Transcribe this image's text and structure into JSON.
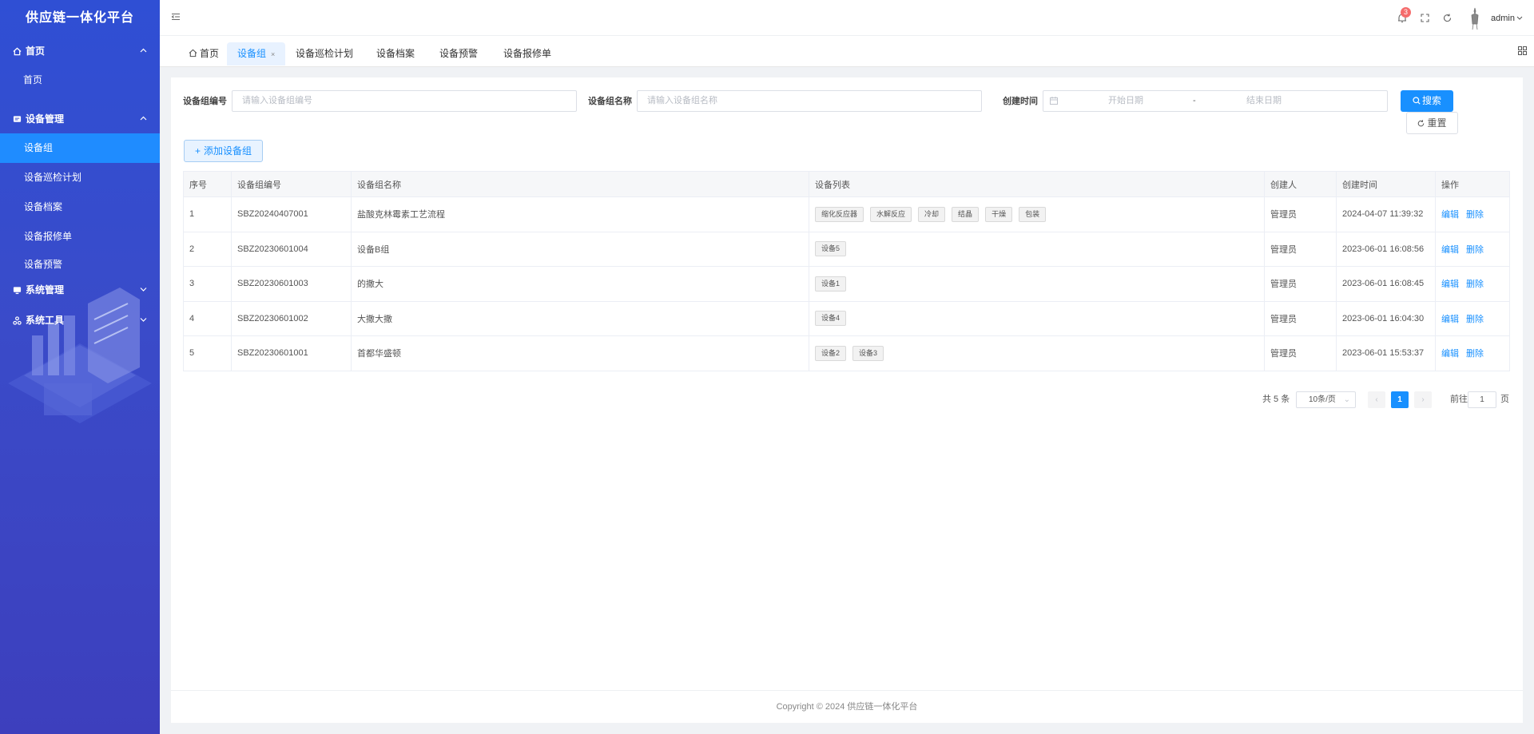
{
  "app": {
    "title": "供应链一体化平台"
  },
  "sidebar": {
    "groups": [
      {
        "label": "首页",
        "icon": "home-icon",
        "expanded": true,
        "items": [
          {
            "label": "首页",
            "active": false
          }
        ]
      },
      {
        "label": "设备管理",
        "icon": "device-icon",
        "expanded": true,
        "items": [
          {
            "label": "设备组",
            "active": true
          },
          {
            "label": "设备巡检计划",
            "active": false
          },
          {
            "label": "设备档案",
            "active": false
          },
          {
            "label": "设备报修单",
            "active": false
          },
          {
            "label": "设备预警",
            "active": false
          }
        ]
      },
      {
        "label": "系统管理",
        "icon": "monitor-icon",
        "expanded": false,
        "items": []
      },
      {
        "label": "系统工具",
        "icon": "tools-icon",
        "expanded": false,
        "items": []
      }
    ]
  },
  "header": {
    "notification_count": "3",
    "username": "admin"
  },
  "tabs": [
    {
      "label": "首页",
      "active": false,
      "closable": false
    },
    {
      "label": "设备组",
      "active": true,
      "closable": true
    },
    {
      "label": "设备巡检计划",
      "active": false,
      "closable": false
    },
    {
      "label": "设备档案",
      "active": false,
      "closable": false
    },
    {
      "label": "设备预警",
      "active": false,
      "closable": false
    },
    {
      "label": "设备报修单",
      "active": false,
      "closable": false
    }
  ],
  "filters": {
    "code_label": "设备组编号",
    "code_placeholder": "请输入设备组编号",
    "name_label": "设备组名称",
    "name_placeholder": "请输入设备组名称",
    "time_label": "创建时间",
    "start_placeholder": "开始日期",
    "range_separator": "-",
    "end_placeholder": "结束日期",
    "search_label": "搜索",
    "reset_label": "重置"
  },
  "toolbar": {
    "add_label": "添加设备组"
  },
  "table": {
    "columns": [
      "序号",
      "设备组编号",
      "设备组名称",
      "设备列表",
      "创建人",
      "创建时间",
      "操作"
    ],
    "rows": [
      {
        "index": "1",
        "code": "SBZ20240407001",
        "name": "盐酸克林霉素工艺流程",
        "devices": [
          "缩化反应器",
          "水解反应",
          "冷却",
          "结晶",
          "干燥",
          "包装"
        ],
        "creator": "管理员",
        "created": "2024-04-07 11:39:32"
      },
      {
        "index": "2",
        "code": "SBZ20230601004",
        "name": "设备B组",
        "devices": [
          "设备5"
        ],
        "creator": "管理员",
        "created": "2023-06-01 16:08:56"
      },
      {
        "index": "3",
        "code": "SBZ20230601003",
        "name": "的撒大",
        "devices": [
          "设备1"
        ],
        "creator": "管理员",
        "created": "2023-06-01 16:08:45"
      },
      {
        "index": "4",
        "code": "SBZ20230601002",
        "name": "大撒大撒",
        "devices": [
          "设备4"
        ],
        "creator": "管理员",
        "created": "2023-06-01 16:04:30"
      },
      {
        "index": "5",
        "code": "SBZ20230601001",
        "name": "首都华盛顿",
        "devices": [
          "设备2",
          "设备3"
        ],
        "creator": "管理员",
        "created": "2023-06-01 15:53:37"
      }
    ],
    "actions": {
      "edit": "编辑",
      "delete": "删除"
    }
  },
  "pagination": {
    "total_text": "共 5 条",
    "page_size": "10条/页",
    "current_page": "1",
    "goto_prefix": "前往",
    "goto_value": "1",
    "goto_suffix": "页"
  },
  "footer": {
    "text": "Copyright © 2024 供应链一体化平台"
  },
  "colors": {
    "primary": "#1890ff",
    "sidebar": "#3a4bc9",
    "danger": "#f56c6c"
  }
}
